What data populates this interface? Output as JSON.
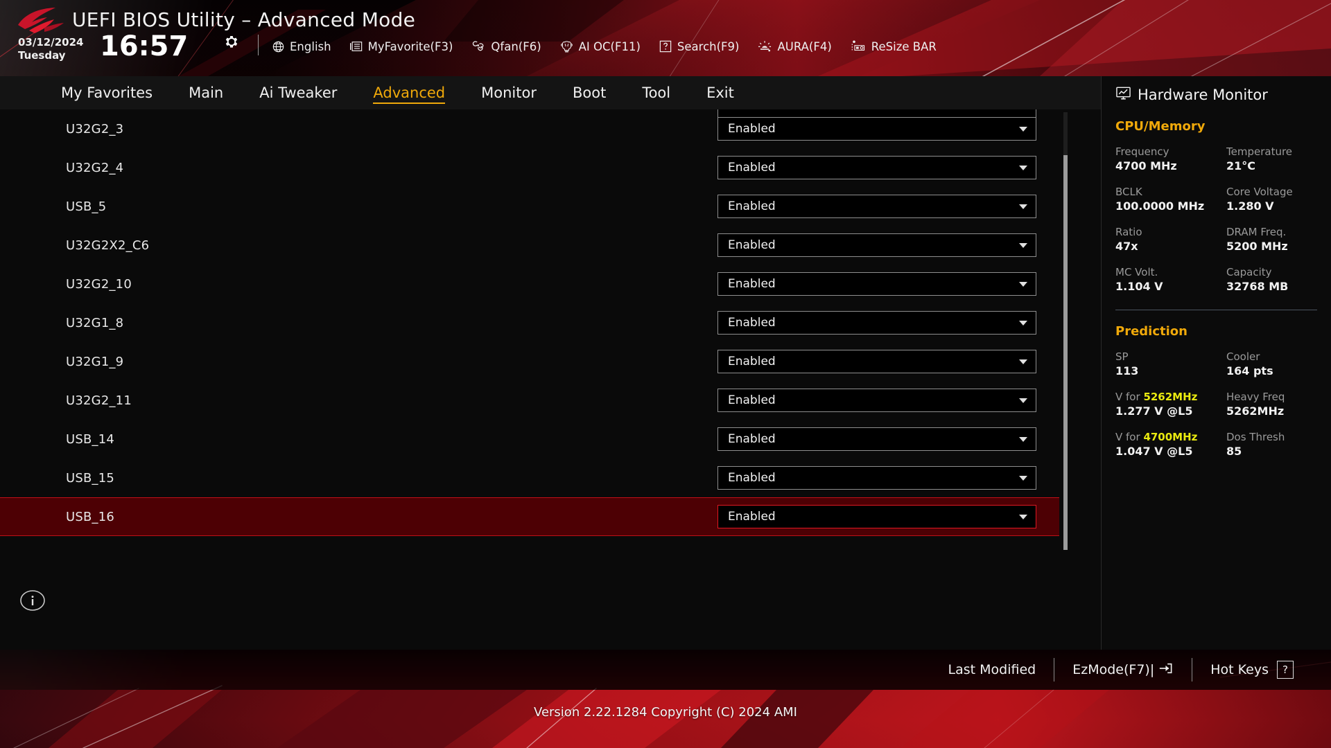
{
  "header": {
    "title": "UEFI BIOS Utility – Advanced Mode",
    "date": "03/12/2024",
    "weekday": "Tuesday",
    "time": "16:57",
    "gear_icon": "gear-icon",
    "tools": [
      {
        "label": "English",
        "icon": "globe-icon"
      },
      {
        "label": "MyFavorite(F3)",
        "icon": "favorites-list-icon"
      },
      {
        "label": "Qfan(F6)",
        "icon": "fan-icon"
      },
      {
        "label": "AI OC(F11)",
        "icon": "brain-icon"
      },
      {
        "label": "Search(F9)",
        "icon": "search-question-icon"
      },
      {
        "label": "AURA(F4)",
        "icon": "aura-light-icon"
      },
      {
        "label": "ReSize BAR",
        "icon": "resize-bar-icon"
      }
    ]
  },
  "nav": {
    "active": "Advanced",
    "items": [
      {
        "label": "My Favorites"
      },
      {
        "label": "Main"
      },
      {
        "label": "Ai Tweaker"
      },
      {
        "label": "Advanced"
      },
      {
        "label": "Monitor"
      },
      {
        "label": "Boot"
      },
      {
        "label": "Tool"
      },
      {
        "label": "Exit"
      }
    ]
  },
  "main": {
    "info_icon": "info-icon",
    "rows": [
      {
        "label": "U32G2_3",
        "value": "Enabled",
        "selected": false
      },
      {
        "label": "U32G2_4",
        "value": "Enabled",
        "selected": false
      },
      {
        "label": "USB_5",
        "value": "Enabled",
        "selected": false
      },
      {
        "label": "U32G2X2_C6",
        "value": "Enabled",
        "selected": false
      },
      {
        "label": "U32G2_10",
        "value": "Enabled",
        "selected": false
      },
      {
        "label": "U32G1_8",
        "value": "Enabled",
        "selected": false
      },
      {
        "label": "U32G1_9",
        "value": "Enabled",
        "selected": false
      },
      {
        "label": "U32G2_11",
        "value": "Enabled",
        "selected": false
      },
      {
        "label": "USB_14",
        "value": "Enabled",
        "selected": false
      },
      {
        "label": "USB_15",
        "value": "Enabled",
        "selected": false
      },
      {
        "label": "USB_16",
        "value": "Enabled",
        "selected": true
      }
    ]
  },
  "hardware_monitor": {
    "title": "Hardware Monitor",
    "title_icon": "monitor-chart-icon",
    "sections": [
      {
        "name": "CPU/Memory",
        "entries": [
          {
            "key": "Frequency",
            "value": "4700 MHz"
          },
          {
            "key": "Temperature",
            "value": "21°C"
          },
          {
            "key": "BCLK",
            "value": "100.0000 MHz"
          },
          {
            "key": "Core Voltage",
            "value": "1.280 V"
          },
          {
            "key": "Ratio",
            "value": "47x"
          },
          {
            "key": "DRAM Freq.",
            "value": "5200 MHz"
          },
          {
            "key": "MC Volt.",
            "value": "1.104 V"
          },
          {
            "key": "Capacity",
            "value": "32768 MB"
          }
        ]
      },
      {
        "name": "Prediction",
        "entries": [
          {
            "key": "SP",
            "value": "113"
          },
          {
            "key": "Cooler",
            "value": "164 pts"
          },
          {
            "key": "V for ",
            "key_hl": "5262MHz",
            "value": "1.277 V @L5"
          },
          {
            "key": "Heavy Freq",
            "value": "5262MHz"
          },
          {
            "key": "V for ",
            "key_hl": "4700MHz",
            "value": "1.047 V @L5"
          },
          {
            "key": "Dos Thresh",
            "value": "85"
          }
        ]
      }
    ]
  },
  "footer": {
    "links": [
      {
        "label": "Last Modified",
        "icon": ""
      },
      {
        "label": "EzMode(F7)|",
        "icon": "arrow-into-box-icon"
      },
      {
        "label": "Hot Keys",
        "icon": "question-key-icon"
      }
    ],
    "version": "Version 2.22.1284 Copyright (C) 2024 AMI"
  },
  "colors": {
    "accent_gold": "#f0a90a",
    "highlight_yellow": "#eaea10",
    "selected_row_bg": "#4d0004",
    "selected_row_border": "#c01018"
  }
}
